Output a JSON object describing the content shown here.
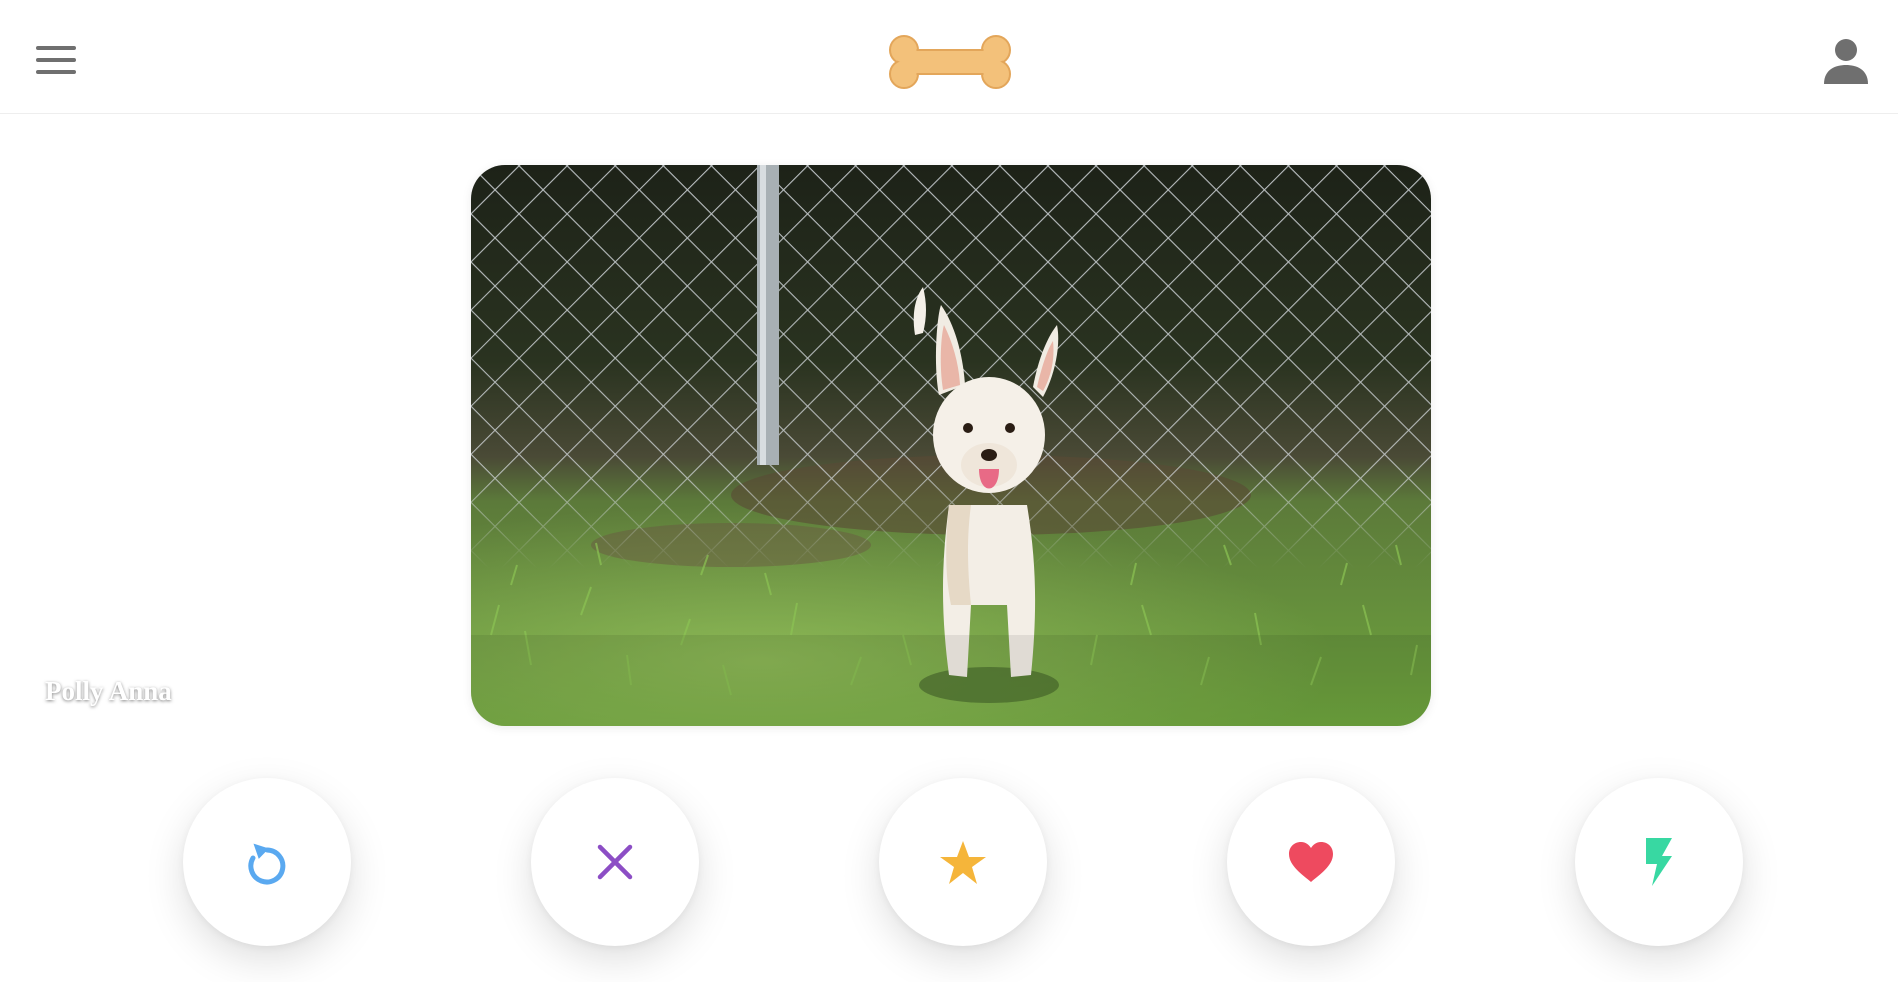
{
  "header": {
    "menu_icon": "hamburger-menu-icon",
    "logo_icon": "bone-logo-icon",
    "profile_icon": "person-icon"
  },
  "card": {
    "name": "Polly Anna",
    "photo_icon": "dog-photo"
  },
  "actions": [
    {
      "id": "rewind",
      "icon": "rewind-icon",
      "color": "#5aa9f0"
    },
    {
      "id": "nope",
      "icon": "close-icon",
      "color": "#8c4ec5"
    },
    {
      "id": "super_like",
      "icon": "star-icon",
      "color": "#f5b53a"
    },
    {
      "id": "like",
      "icon": "heart-icon",
      "color": "#ee4a5f"
    },
    {
      "id": "boost",
      "icon": "lightning-icon",
      "color": "#38d8a2"
    }
  ],
  "colors": {
    "icon_gray": "#6f6f6f",
    "bone": "#f3c17a"
  }
}
